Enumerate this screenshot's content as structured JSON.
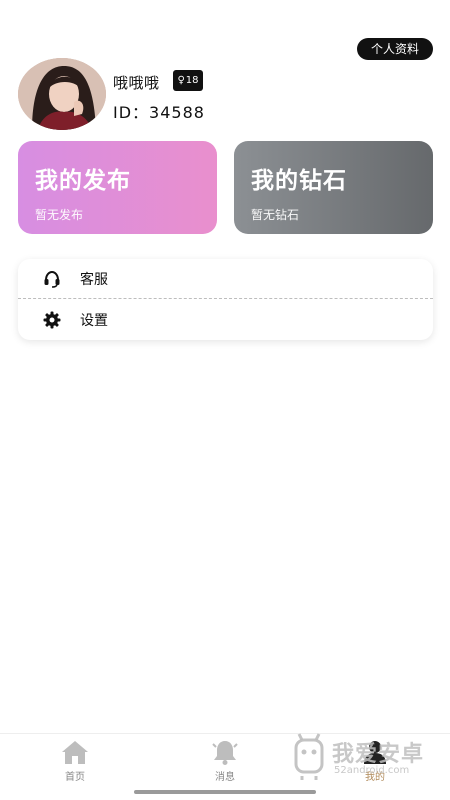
{
  "header": {
    "profile_button_label": "个人资料"
  },
  "user": {
    "nickname": "哦哦哦",
    "gender_badge": "18",
    "id_text": "ID：34588",
    "avatar_icon": "user-photo"
  },
  "cards": {
    "publish": {
      "title": "我的发布",
      "subtitle": "暂无发布"
    },
    "diamond": {
      "title": "我的钻石",
      "subtitle": "暂无钻石"
    }
  },
  "menu": {
    "items": [
      {
        "label": "客服",
        "icon": "headset-icon"
      },
      {
        "label": "设置",
        "icon": "gear-icon"
      }
    ]
  },
  "tabbar": {
    "items": [
      {
        "label": "首页",
        "icon": "home-icon"
      },
      {
        "label": "消息",
        "icon": "bell-icon"
      },
      {
        "label": "我的",
        "icon": "person-icon"
      }
    ]
  },
  "watermark": {
    "text": "我爱安卓",
    "url": "52android.com"
  },
  "colors": {
    "publish_gradient": [
      "#d78ee2",
      "#e98fcd"
    ],
    "diamond_gradient": [
      "#8c9094",
      "#66696c"
    ],
    "dark": "#111111"
  }
}
